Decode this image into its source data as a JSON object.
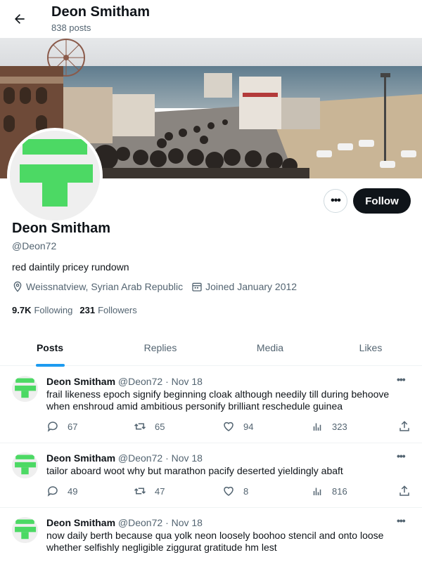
{
  "header": {
    "back_icon": "arrow-left-icon",
    "name": "Deon Smitham",
    "post_count": "838 posts"
  },
  "profile": {
    "name": "Deon Smitham",
    "handle": "@Deon72",
    "bio": "red daintily pricey rundown",
    "location": "Weissnatview, Syrian Arab Republic",
    "joined": "Joined January 2012",
    "following_count": "9.7K",
    "following_label": "Following",
    "followers_count": "231",
    "followers_label": "Followers",
    "more_label": "•••",
    "follow_label": "Follow",
    "avatar_color": "#4cd964"
  },
  "tabs": [
    {
      "label": "Posts",
      "active": true
    },
    {
      "label": "Replies",
      "active": false
    },
    {
      "label": "Media",
      "active": false
    },
    {
      "label": "Likes",
      "active": false
    }
  ],
  "tweets": [
    {
      "name": "Deon Smitham",
      "handle": "@Deon72",
      "date": "· Nov 18",
      "text": "frail likeness epoch signify beginning cloak although needily till during behoove when enshroud amid ambitious personify brilliant reschedule guinea",
      "replies": "67",
      "reposts": "65",
      "likes": "94",
      "views": "323"
    },
    {
      "name": "Deon Smitham",
      "handle": "@Deon72",
      "date": "· Nov 18",
      "text": "tailor aboard woot why but marathon pacify deserted yieldingly abaft",
      "replies": "49",
      "reposts": "47",
      "likes": "8",
      "views": "816"
    },
    {
      "name": "Deon Smitham",
      "handle": "@Deon72",
      "date": "· Nov 18",
      "text": "now daily berth because qua yolk neon loosely boohoo stencil and onto loose whether selfishly negligible ziggurat gratitude hm lest",
      "replies": "",
      "reposts": "",
      "likes": "",
      "views": ""
    }
  ],
  "colors": {
    "accent": "#1d9bf0",
    "text": "#0f1419",
    "muted": "#536471",
    "border": "#eff3f4"
  }
}
